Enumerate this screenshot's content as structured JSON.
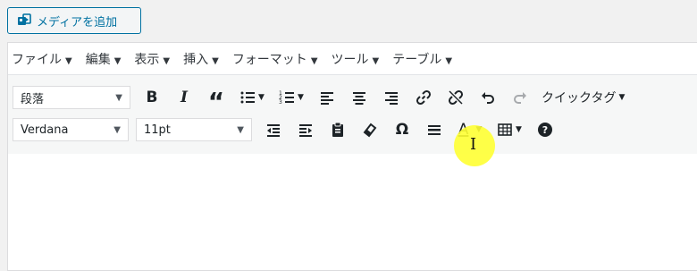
{
  "media_button": {
    "label": "メディアを追加",
    "icon": "media-icon"
  },
  "menubar": {
    "items": [
      "ファイル",
      "編集",
      "表示",
      "挿入",
      "フォーマット",
      "ツール",
      "テーブル"
    ]
  },
  "toolbar": {
    "format_select": "段落",
    "font_family_select": "Verdana",
    "font_size_select": "11pt",
    "quicktags_label": "クイックタグ"
  },
  "colors": {
    "accent": "#0071a1",
    "highlight": "#ffff33"
  }
}
